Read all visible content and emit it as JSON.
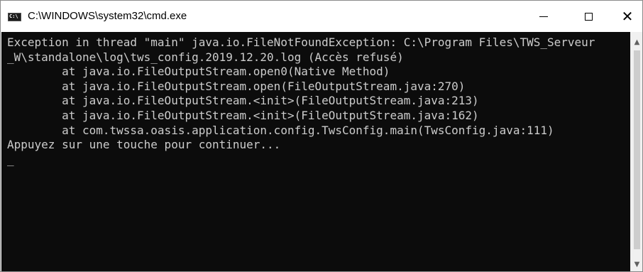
{
  "window": {
    "title": "C:\\WINDOWS\\system32\\cmd.exe",
    "app_icon_text": "C:\\",
    "minimize_glyph": "—",
    "maximize_glyph": "□",
    "close_glyph": "✕"
  },
  "console": {
    "background_color": "#0c0c0c",
    "text_color": "#cccccc",
    "lines": [
      "Exception in thread \"main\" java.io.FileNotFoundException: C:\\Program Files\\TWS_Serveur",
      "_W\\standalone\\log\\tws_config.2019.12.20.log (Accès refusé)",
      "        at java.io.FileOutputStream.open0(Native Method)",
      "        at java.io.FileOutputStream.open(FileOutputStream.java:270)",
      "        at java.io.FileOutputStream.<init>(FileOutputStream.java:213)",
      "        at java.io.FileOutputStream.<init>(FileOutputStream.java:162)",
      "        at com.twssa.oasis.application.config.TwsConfig.main(TwsConfig.java:111)",
      "Appuyez sur une touche pour continuer..."
    ]
  },
  "scrollbar": {
    "up_arrow": "▲",
    "down_arrow": "▼"
  }
}
